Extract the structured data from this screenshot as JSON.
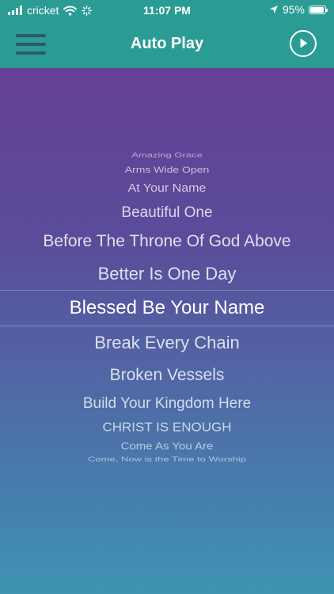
{
  "status_bar": {
    "carrier": "cricket",
    "time": "11:07 PM",
    "battery_percent": "95%",
    "battery_level": 0.95,
    "icons": [
      "signal-icon",
      "wifi-icon",
      "activity-icon",
      "location-arrow-icon",
      "battery-icon"
    ]
  },
  "nav": {
    "title": "Auto Play",
    "menu_icon": "hamburger-menu-icon",
    "play_icon": "play-circle-icon"
  },
  "colors": {
    "header_background": "#2a9c93",
    "menu_icon_color": "#2c5a66",
    "gradient_top": "#6a3a93",
    "gradient_bottom": "#3e93b2",
    "text": "#ffffff"
  },
  "picker": {
    "selected_index": 7,
    "items": [
      "Amazing Grace",
      "Arms Wide Open",
      "At Your Name",
      "Beautiful One",
      "Before The Throne Of God Above",
      "Better Is One Day",
      "Blessed Be Your Name",
      "Break Every Chain",
      "Broken Vessels",
      "Build Your Kingdom Here",
      "CHRIST IS ENOUGH",
      "Come As You Are",
      "Come, Now is the Time to Worship"
    ]
  }
}
